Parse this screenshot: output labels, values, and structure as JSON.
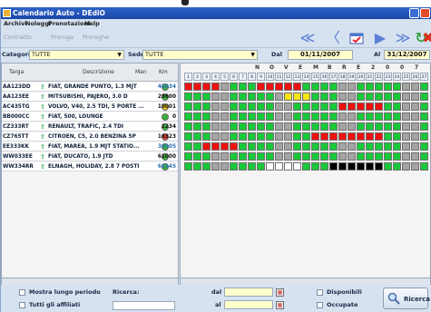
{
  "app": {
    "title": "Calendario Auto - DEdiO",
    "menu": [
      "Archivi",
      "Noleggi",
      "Prenotazioni",
      "Help"
    ],
    "toolbar": {
      "buttons": [
        "Contratto",
        "Proroga",
        "Proroghe"
      ]
    },
    "filters": {
      "categoria_label": "Categoria",
      "categoria_value": "TUTTE",
      "sede_label": "Sede",
      "sede_value": "TUTTE",
      "dal_label": "Dal",
      "dal_value": "01/11/2007",
      "al_label": "Al",
      "al_value": "31/12/2007"
    },
    "table": {
      "headers": [
        "Targa",
        "Descrizione",
        "Man",
        "Km"
      ],
      "rows": [
        {
          "targa": "AA123DD",
          "desc": "FIAT, GRANDE PUNTO, 1.3 MJT",
          "status": "green",
          "km": "45034",
          "km_color": "#2a6fb3"
        },
        {
          "targa": "AA123EE",
          "desc": "MITSUBISHI, PAJERO, 3.0 D",
          "status": "green",
          "km": "28600",
          "km_color": "#111111"
        },
        {
          "targa": "AC435TG",
          "desc": "VOLVO, V40, 2.5 TDI, 5 PORTE ...",
          "status": "yellow",
          "km": "10001",
          "km_color": "#111111"
        },
        {
          "targa": "BB000CC",
          "desc": "FIAT, 500, LOUNGE",
          "status": "green",
          "km": "0",
          "km_color": "#111111"
        },
        {
          "targa": "CZ333RT",
          "desc": "RENAULT, TRAFIC, 2.4 TDI",
          "status": "green",
          "km": "1234",
          "km_color": "#111111"
        },
        {
          "targa": "CZ765TT",
          "desc": "CITROEN, C5, 2.0 BENZINA 5P",
          "status": "red",
          "km": "16323",
          "km_color": "#111111"
        },
        {
          "targa": "EE333KK",
          "desc": "FIAT, MAREA, 1.9 MJT STATIO...",
          "status": "green",
          "km": "30505",
          "km_color": "#2a6fb3"
        },
        {
          "targa": "WW033EE",
          "desc": "FIAT, DUCATO, 1.9 JTD",
          "status": "green",
          "km": "61000",
          "km_color": "#111111"
        },
        {
          "targa": "WW334RR",
          "desc": "ELNAGH, HOLIDAY, 2.8 7 POSTI",
          "status": "green",
          "km": "62345",
          "km_color": "#2a6fb3"
        }
      ]
    },
    "calendar": {
      "month_label": [
        "N",
        "O",
        "V",
        "E",
        "M",
        "B",
        "R",
        "E",
        "2",
        "0",
        "0",
        "7"
      ],
      "days": [
        "1",
        "2",
        "3",
        "4",
        "5",
        "6",
        "7",
        "8",
        "9",
        "10",
        "11",
        "12",
        "13",
        "14",
        "15",
        "16",
        "17",
        "18",
        "19",
        "20",
        "21",
        "22",
        "23",
        "24",
        "25",
        "26",
        "27"
      ],
      "colors": {
        "green": "#19c93a",
        "red": "#ee1111",
        "yellow": "#f5e612",
        "white": "#ffffff",
        "black": "#000000",
        "gray": "#a4a4a4"
      },
      "rows": [
        "RRRRGGGGRRRRRGGGGGGGGGGGGGG",
        "GGGGGGGGGGGYYYGGGGGGGGGGGGG",
        "GGGGGGGGGGGGGGGGGRRRRRGGGGG",
        "GGGGGGGGGGGGGGGGGGGGGGGGGGG",
        "GGGGGGGGGGGGGGGGGGGGGGGGGGG",
        "GGGGGGGGGGGGGGRRRRRRRRGGGGG",
        "GGRRRRGGGGGGGGGGGGGGGGGGGGG",
        "GGGGGGGGGGGGGGGGGGGGGGGGGGG",
        "GGGGGGGGGWWWWGGGKKKKKKGGGGG"
      ],
      "weekend_days": [
        3,
        4,
        10,
        11,
        17,
        18,
        24,
        25
      ]
    },
    "bottom": {
      "mostra_label": "Mostra lungo periodo",
      "tutti_label": "Tutti gli affiliati",
      "ricerca_label": "Ricerca:",
      "dal_label": "dal",
      "al_label": "al",
      "disponibili_label": "Disponibili",
      "occupate_label": "Occupate",
      "ricerca_button": "Ricerca"
    }
  }
}
